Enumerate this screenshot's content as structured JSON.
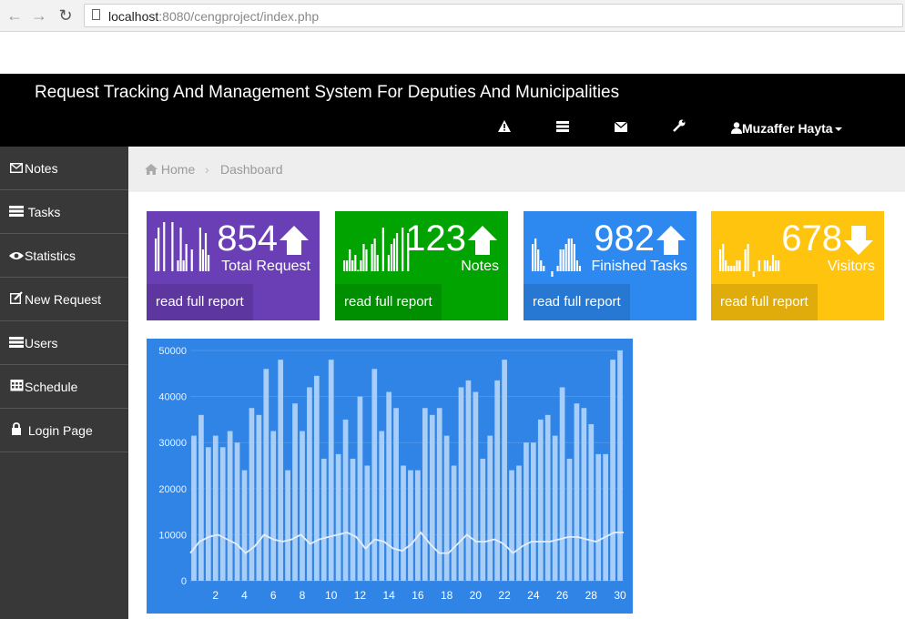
{
  "browser": {
    "url_host": "localhost",
    "url_path": ":8080/cengproject/index.php"
  },
  "header": {
    "title": "Request Tracking And Management System For Deputies And Municipalities",
    "user_name": "Muzaffer Hayta"
  },
  "sidebar": {
    "items": [
      {
        "label": "Notes",
        "icon": "envelope-icon"
      },
      {
        "label": "Tasks",
        "icon": "list-icon"
      },
      {
        "label": "Statistics",
        "icon": "eye-icon"
      },
      {
        "label": "New Request",
        "icon": "edit-icon"
      },
      {
        "label": "Users",
        "icon": "users-list-icon"
      },
      {
        "label": "Schedule",
        "icon": "calendar-icon"
      },
      {
        "label": "Login Page",
        "icon": "lock-icon"
      }
    ]
  },
  "breadcrumb": {
    "home": "Home",
    "current": "Dashboard"
  },
  "cards": [
    {
      "value": "854",
      "label": "Total Request",
      "report": "read full report",
      "trend": "up",
      "color": "#6a3eb5",
      "spark": [
        6,
        8,
        -1,
        9,
        -1,
        -1,
        9,
        -1,
        2,
        8,
        2,
        5,
        -1,
        4,
        -1,
        -1,
        8,
        4,
        7,
        3,
        -1,
        -1,
        -1,
        -1
      ]
    },
    {
      "value": "123",
      "label": "Notes",
      "report": "read full report",
      "trend": "up",
      "color": "#00a300",
      "spark": [
        2,
        2,
        4,
        2,
        3,
        0,
        2,
        5,
        4,
        -1,
        5,
        6,
        3,
        -1,
        8,
        -1,
        3,
        5,
        6,
        7,
        -1,
        8,
        -1,
        7
      ]
    },
    {
      "value": "982",
      "label": "Finished Tasks",
      "report": "read full report",
      "trend": "up",
      "color": "#2d89ef",
      "spark": [
        5,
        6,
        4,
        2,
        1,
        -1,
        -1,
        -4,
        -1,
        1,
        4,
        4,
        5,
        6,
        6,
        5,
        2,
        1,
        -1,
        -1,
        -1,
        -1,
        -1,
        -1
      ]
    },
    {
      "value": "678",
      "label": "Visitors",
      "report": "read full report",
      "trend": "down",
      "color": "#ffc40d",
      "spark": [
        4,
        5,
        2,
        1,
        1,
        1,
        2,
        2,
        -1,
        4,
        5,
        -1,
        -3,
        -1,
        2,
        -1,
        2,
        2,
        1,
        3,
        2,
        2,
        -1,
        -1
      ]
    }
  ],
  "colors": {
    "chart_bg": "#2f84e6",
    "bar": "#a8cdf7",
    "line": "#e6eef8"
  },
  "chart_data": {
    "type": "bar",
    "x": [
      1,
      2,
      3,
      4,
      5,
      6,
      7,
      8,
      9,
      10,
      11,
      12,
      13,
      14,
      15,
      16,
      17,
      18,
      19,
      20,
      21,
      22,
      23,
      24,
      25,
      26,
      27,
      28,
      29,
      30,
      31,
      32,
      33,
      34,
      35,
      36,
      37,
      38,
      39,
      40,
      41,
      42,
      43,
      44,
      45,
      46,
      47,
      48,
      49,
      50,
      51,
      52,
      53,
      54,
      55,
      56,
      57,
      58,
      59,
      60
    ],
    "x_tick_labels": [
      "2",
      "4",
      "6",
      "8",
      "10",
      "12",
      "14",
      "16",
      "18",
      "20",
      "22",
      "24",
      "26",
      "28",
      "30"
    ],
    "y_tick_labels": [
      "0",
      "10000",
      "20000",
      "30000",
      "40000",
      "50000"
    ],
    "ylim": [
      0,
      50000
    ],
    "series": [
      {
        "type": "bar",
        "values": [
          31500,
          36000,
          29000,
          31500,
          29000,
          32500,
          30000,
          24000,
          37500,
          36000,
          46000,
          32500,
          48000,
          24000,
          38500,
          32500,
          42000,
          44500,
          26500,
          48000,
          27500,
          35000,
          26500,
          40000,
          25000,
          46000,
          32500,
          41000,
          37500,
          25000,
          24000,
          24000,
          37500,
          36000,
          37500,
          31500,
          25000,
          42000,
          43500,
          41000,
          26500,
          31500,
          43500,
          48000,
          24000,
          25000,
          30000,
          30000,
          35000,
          36000,
          31500,
          42000,
          26500,
          38500,
          37500,
          34000,
          27500,
          27500,
          48000,
          50000
        ]
      },
      {
        "type": "line",
        "values": [
          6000,
          8500,
          9500,
          10000,
          9000,
          8000,
          6000,
          7500,
          10000,
          9000,
          8500,
          9000,
          10000,
          8000,
          9000,
          9500,
          10000,
          10500,
          9500,
          7000,
          9000,
          8500,
          7000,
          6500,
          8000,
          10500,
          8000,
          6000,
          6000,
          8000,
          10000,
          8500,
          8500,
          9000,
          8000,
          6000,
          7500,
          8500,
          8500,
          8500,
          9000,
          9500,
          9500,
          9000,
          8500,
          9500,
          10500,
          10500
        ]
      }
    ],
    "grid": true
  }
}
